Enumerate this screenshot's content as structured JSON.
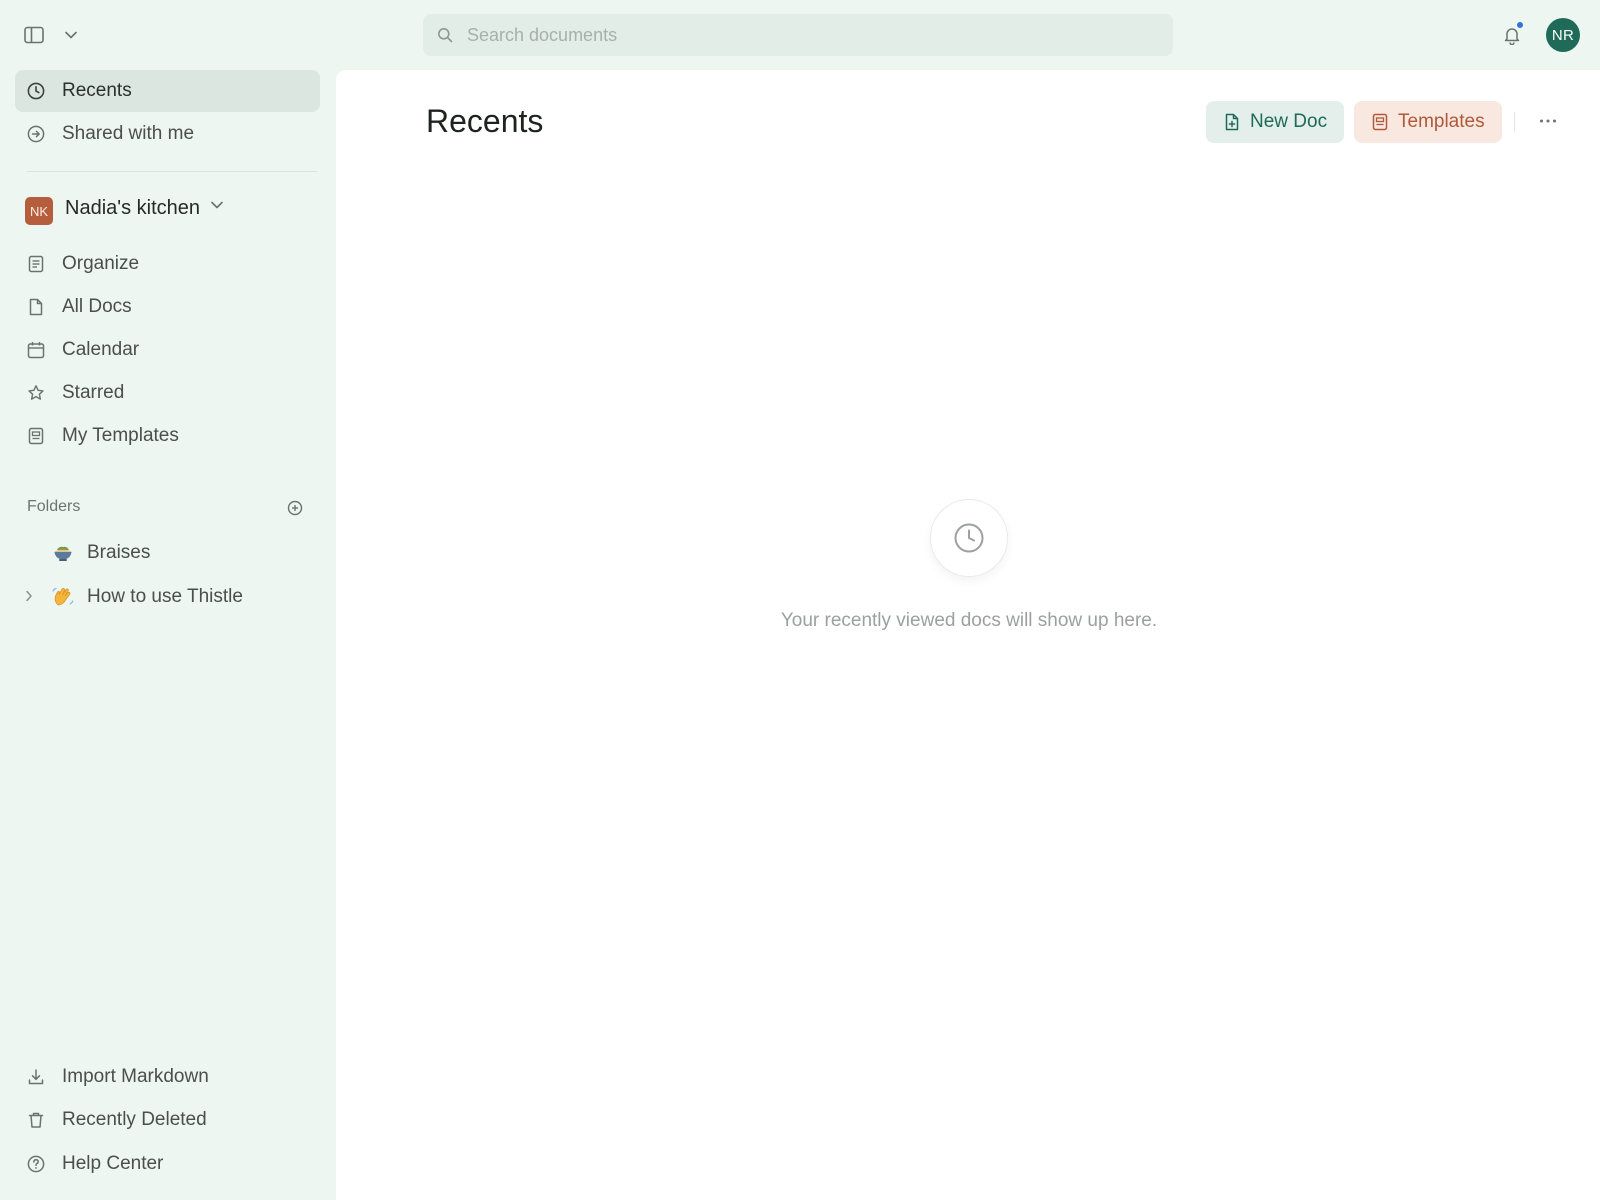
{
  "topbar": {
    "search_placeholder": "Search documents",
    "avatar_initials": "NR",
    "notification_dot_color": "#2f73d9",
    "avatar_color": "#1f6b58"
  },
  "sidebar": {
    "primary": [
      {
        "label": "Recents",
        "icon": "clock-icon",
        "active": true
      },
      {
        "label": "Shared with me",
        "icon": "shared-arrow-icon",
        "active": false
      }
    ],
    "workspace": {
      "initials": "NK",
      "name": "Nadia's kitchen",
      "badge_color": "#b55d3d"
    },
    "workspace_items": [
      {
        "label": "Organize",
        "icon": "organize-icon"
      },
      {
        "label": "All Docs",
        "icon": "doc-icon"
      },
      {
        "label": "Calendar",
        "icon": "calendar-icon"
      },
      {
        "label": "Starred",
        "icon": "star-icon"
      },
      {
        "label": "My Templates",
        "icon": "template-icon"
      }
    ],
    "folders": {
      "label": "Folders",
      "items": [
        {
          "label": "Braises",
          "emoji": "bowl-emoji",
          "expandable": false
        },
        {
          "label": "How to use Thistle",
          "emoji": "waving-hand-emoji",
          "expandable": true
        }
      ]
    },
    "bottom": [
      {
        "label": "Import Markdown",
        "icon": "download-icon"
      },
      {
        "label": "Recently Deleted",
        "icon": "trash-icon"
      },
      {
        "label": "Help Center",
        "icon": "help-icon"
      }
    ]
  },
  "main": {
    "title": "Recents",
    "new_doc_label": "New Doc",
    "templates_label": "Templates",
    "empty_message": "Your recently viewed docs will show up here.",
    "accent_green": "#1d6b57",
    "accent_orange": "#b0593b"
  }
}
